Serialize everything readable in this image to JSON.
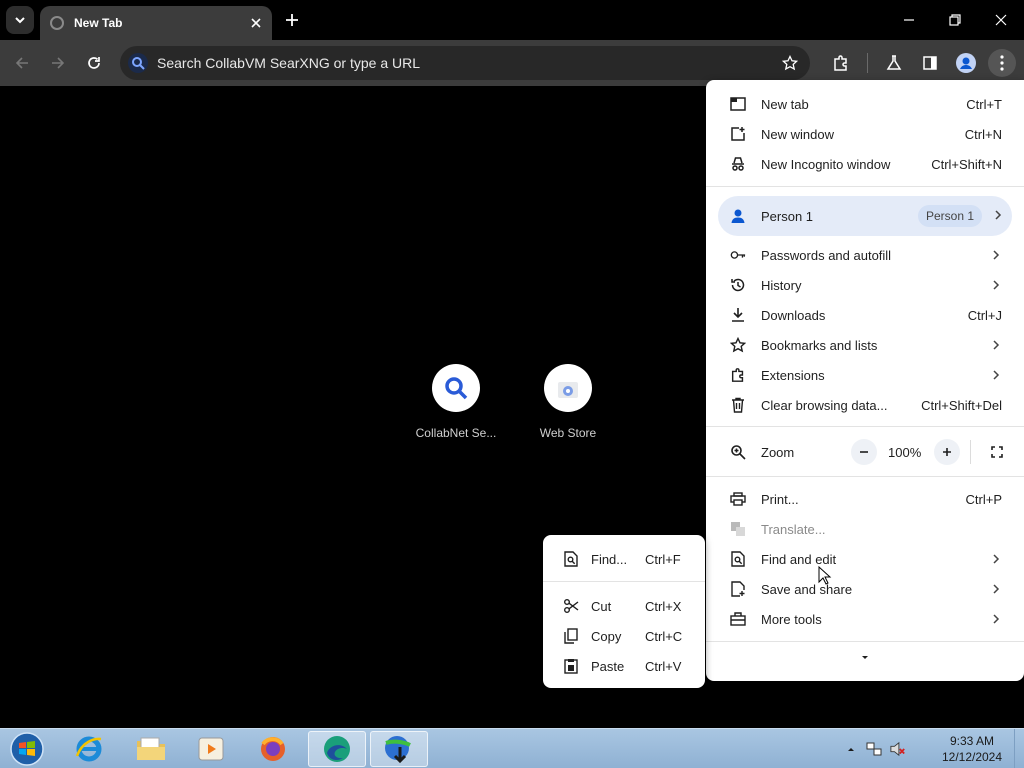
{
  "browser": {
    "tab_title": "New Tab",
    "omnibox_placeholder": "Search CollabVM SearXNG or type a URL"
  },
  "shortcuts": [
    {
      "label": "CollabNet Se..."
    },
    {
      "label": "Web Store"
    }
  ],
  "menu": {
    "new_tab": {
      "label": "New tab",
      "shortcut": "Ctrl+T"
    },
    "new_window": {
      "label": "New window",
      "shortcut": "Ctrl+N"
    },
    "incognito": {
      "label": "New Incognito window",
      "shortcut": "Ctrl+Shift+N"
    },
    "profile": {
      "label": "Person 1",
      "badge": "Person 1"
    },
    "passwords": {
      "label": "Passwords and autofill"
    },
    "history": {
      "label": "History"
    },
    "downloads": {
      "label": "Downloads",
      "shortcut": "Ctrl+J"
    },
    "bookmarks": {
      "label": "Bookmarks and lists"
    },
    "extensions": {
      "label": "Extensions"
    },
    "clear_data": {
      "label": "Clear browsing data...",
      "shortcut": "Ctrl+Shift+Del"
    },
    "zoom": {
      "label": "Zoom",
      "value": "100%"
    },
    "print": {
      "label": "Print...",
      "shortcut": "Ctrl+P"
    },
    "translate": {
      "label": "Translate..."
    },
    "find_edit": {
      "label": "Find and edit"
    },
    "save_share": {
      "label": "Save and share"
    },
    "more_tools": {
      "label": "More tools"
    }
  },
  "submenu": {
    "find": {
      "label": "Find...",
      "shortcut": "Ctrl+F"
    },
    "cut": {
      "label": "Cut",
      "shortcut": "Ctrl+X"
    },
    "copy": {
      "label": "Copy",
      "shortcut": "Ctrl+C"
    },
    "paste": {
      "label": "Paste",
      "shortcut": "Ctrl+V"
    }
  },
  "taskbar": {
    "time": "9:33 AM",
    "date": "12/12/2024"
  },
  "colors": {
    "accent": "#0b57d0",
    "menu_highlight": "#e4ebf8"
  }
}
